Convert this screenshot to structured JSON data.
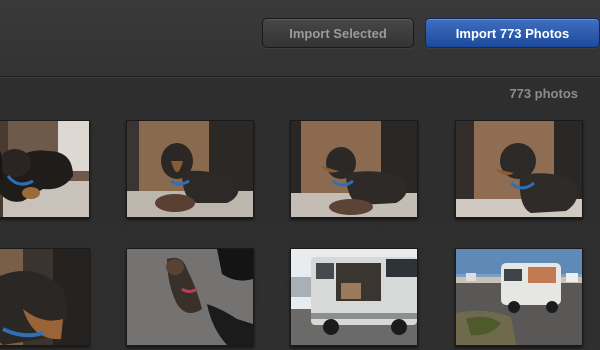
{
  "toolbar": {
    "import_selected_label": "Import Selected",
    "import_all_label": "Import 773 Photos"
  },
  "library": {
    "photo_count_label": "773 photos"
  },
  "colors": {
    "primary_button": "#2a5cb0",
    "background": "#2f2f2f",
    "count_text": "#8c8c8c"
  },
  "photos": [
    {
      "subject": "dog-on-blanket"
    },
    {
      "subject": "dog-by-door"
    },
    {
      "subject": "dog-by-door-profile"
    },
    {
      "subject": "dog-by-door-closeup"
    },
    {
      "subject": "dog-head-closeup"
    },
    {
      "subject": "dog-on-asphalt"
    },
    {
      "subject": "van-open-door"
    },
    {
      "subject": "van-in-parking-lot"
    }
  ]
}
